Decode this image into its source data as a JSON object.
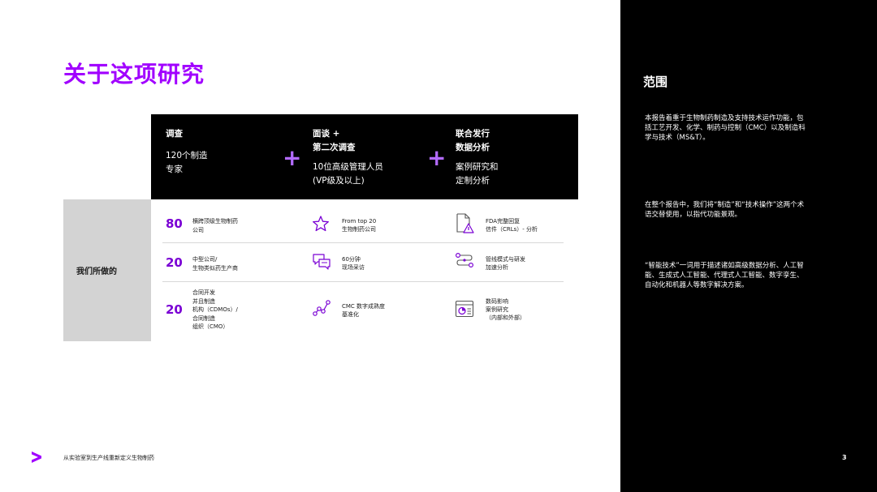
{
  "title": "关于这项研究",
  "header_band": {
    "col1": {
      "head": "调查",
      "sub1": "120个制造",
      "sub2": "专家"
    },
    "col2": {
      "head1": "面谈 +",
      "head2": "第二次调查",
      "sub1": "10位高级管理人员",
      "sub2": "(VP级及以上)"
    },
    "col3": {
      "head1": "联合发行",
      "head2": "数据分析",
      "sub1": "案例研究和",
      "sub2": "定制分析"
    },
    "plus": "+"
  },
  "what_we_did": "我们所做的",
  "stats": [
    {
      "number": "80",
      "line1": "横跨顶级生物制药",
      "line2": "公司"
    },
    {
      "number": "20",
      "line1": "中型公司/",
      "line2": "生物类似药生产商"
    },
    {
      "number": "20",
      "line1": "合同开发",
      "line2": "并且制造",
      "line3": "机构（CDMOs）/",
      "line4": "合同制造",
      "line5": "组织（CMO）"
    }
  ],
  "mid_items": [
    {
      "icon": "star-icon",
      "line1": "From top 20",
      "line2": "生物制药公司"
    },
    {
      "icon": "chat-bubbles-icon",
      "line1": "60分钟",
      "line2": "现场采访"
    },
    {
      "icon": "network-nodes-icon",
      "line1": "CMC 数字成熟度",
      "line2": "基准化"
    }
  ],
  "right_items": [
    {
      "icon": "document-warning-icon",
      "line1": "FDA完整回复",
      "line2": "信件（CRLs）- 分析"
    },
    {
      "icon": "pipeline-icon",
      "line1": "管线模式与研发",
      "line2": "加速分析"
    },
    {
      "icon": "dashboard-icon",
      "line1": "数码影响",
      "line2": "案例研究",
      "line3": "（内部和外部）"
    }
  ],
  "scope": {
    "heading": "范围",
    "para1": "本报告着重于生物制药制造及支持技术运作功能，包括工艺开发、化学、制药与控制（CMC）以及制造科学与技术（MS&T）。",
    "para2": "在整个报告中，我们将“制造”和“技术操作”这两个术语交替使用，以指代功能景观。",
    "para3": "“智能技术”一词用于描述诸如高级数据分析、人工智能、生成式人工智能、代理式人工智能、数字孪生、自动化和机器人等数字解决方案。"
  },
  "footer": {
    "text": "从实验室到生产线重新定义生物制药",
    "page": "3"
  },
  "colors": {
    "accent": "#a100ff",
    "number": "#7a00d4",
    "plus": "#b36bff"
  }
}
